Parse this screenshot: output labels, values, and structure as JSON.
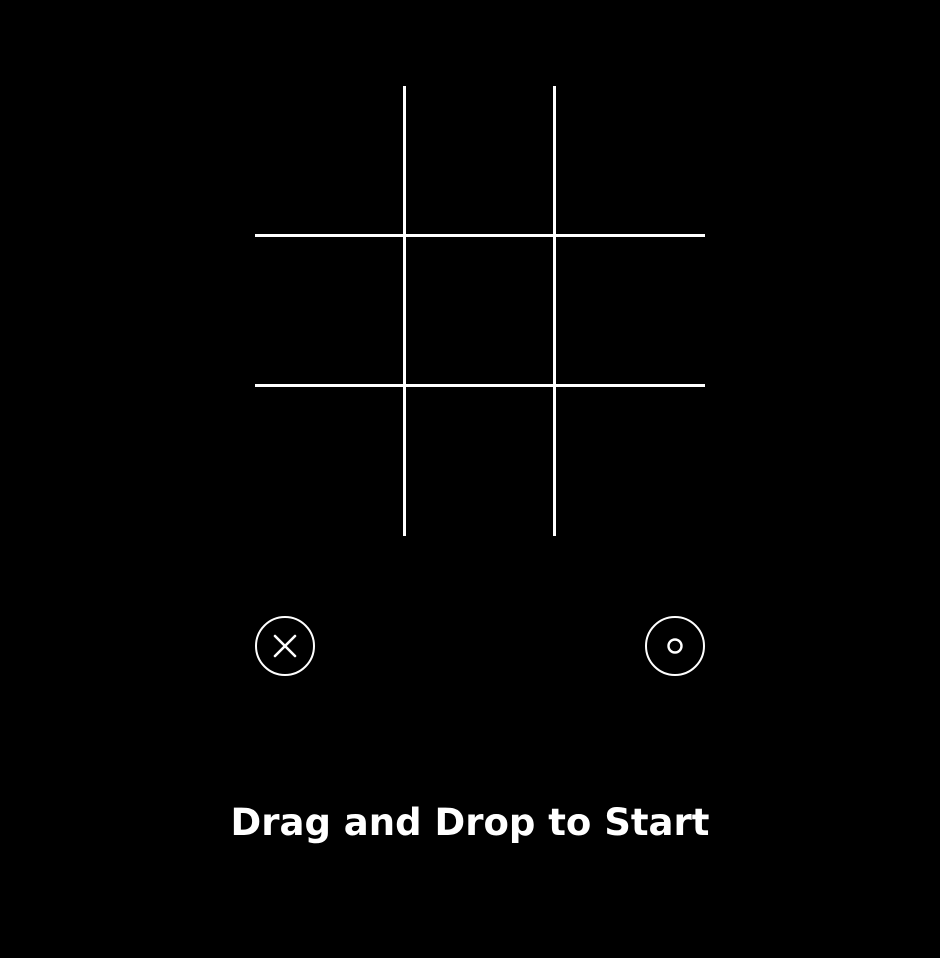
{
  "game": {
    "type": "tic-tac-toe",
    "board": [
      [
        "",
        "",
        ""
      ],
      [
        "",
        "",
        ""
      ],
      [
        "",
        "",
        ""
      ]
    ]
  },
  "pieces": [
    {
      "id": "x",
      "icon": "x-icon"
    },
    {
      "id": "o",
      "icon": "o-icon"
    }
  ],
  "status": {
    "message": "Drag and Drop to Start"
  },
  "colors": {
    "background": "#000000",
    "foreground": "#ffffff"
  }
}
